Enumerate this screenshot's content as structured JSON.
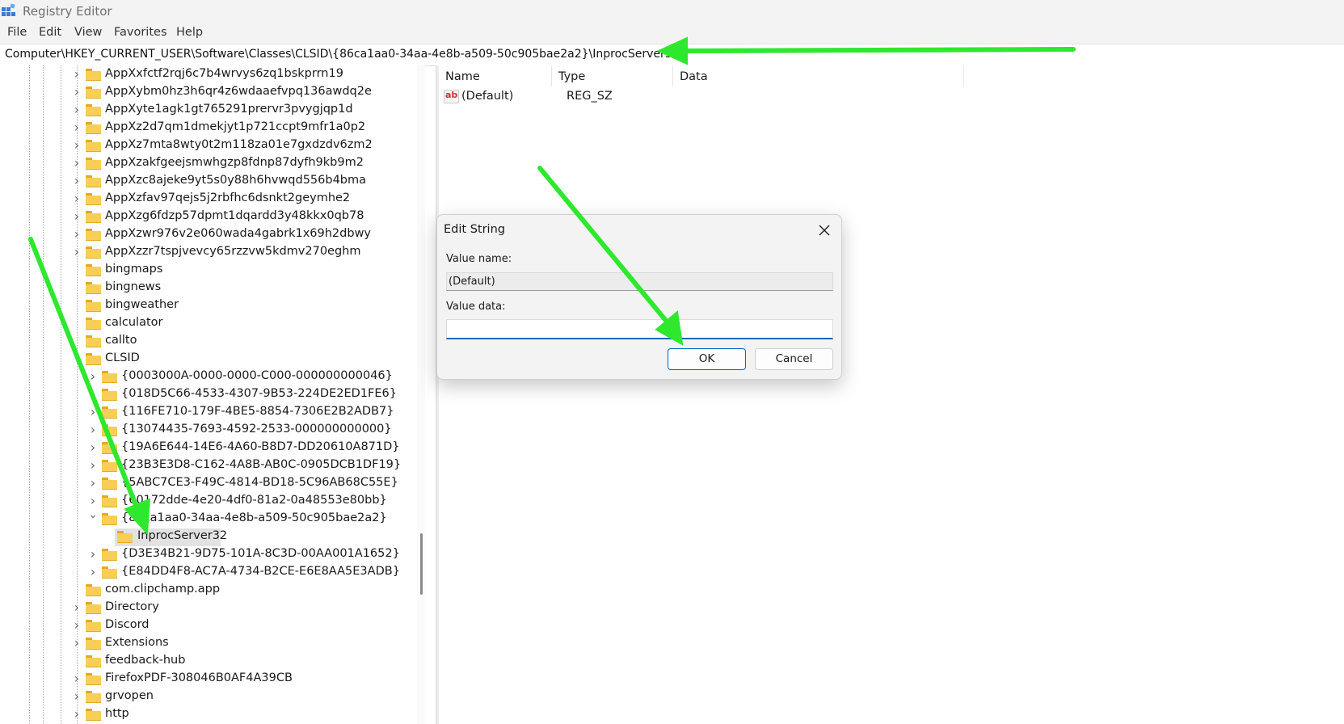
{
  "window": {
    "title": "Registry Editor"
  },
  "menu": [
    "File",
    "Edit",
    "View",
    "Favorites",
    "Help"
  ],
  "address": {
    "path": "Computer\\HKEY_CURRENT_USER\\Software\\Classes\\CLSID\\{86ca1aa0-34aa-4e8b-a509-50c905bae2a2}\\InprocServer32"
  },
  "tree": {
    "items": [
      {
        "label": "AppXxfctf2rqj6c7b4wrvys6zq1bskprrn19",
        "level": 1,
        "expander": "collapsed"
      },
      {
        "label": "AppXybm0hz3h6qr4z6wdaaefvpq136awdq2e",
        "level": 1,
        "expander": "collapsed"
      },
      {
        "label": "AppXyte1agk1gt765291prervr3pvygjqp1d",
        "level": 1,
        "expander": "collapsed"
      },
      {
        "label": "AppXz2d7qm1dmekjyt1p721ccpt9mfr1a0p2",
        "level": 1,
        "expander": "collapsed"
      },
      {
        "label": "AppXz7mta8wty0t2m118za01e7gxdzdv6zm2",
        "level": 1,
        "expander": "collapsed"
      },
      {
        "label": "AppXzakfgeejsmwhgzp8fdnp87dyfh9kb9m2",
        "level": 1,
        "expander": "collapsed"
      },
      {
        "label": "AppXzc8ajeke9yt5s0y88h6hvwqd556b4bma",
        "level": 1,
        "expander": "collapsed"
      },
      {
        "label": "AppXzfav97qejs5j2rbfhc6dsnkt2geymhe2",
        "level": 1,
        "expander": "collapsed"
      },
      {
        "label": "AppXzg6fdzp57dpmt1dqardd3y48kkx0qb78",
        "level": 1,
        "expander": "collapsed"
      },
      {
        "label": "AppXzwr976v2e060wada4gabrk1x69h2dbwy",
        "level": 1,
        "expander": "collapsed"
      },
      {
        "label": "AppXzzr7tspjvevcy65rzzvw5kdmv270eghm",
        "level": 1,
        "expander": "collapsed"
      },
      {
        "label": "bingmaps",
        "level": 1,
        "expander": "none"
      },
      {
        "label": "bingnews",
        "level": 1,
        "expander": "none"
      },
      {
        "label": "bingweather",
        "level": 1,
        "expander": "none"
      },
      {
        "label": "calculator",
        "level": 1,
        "expander": "none"
      },
      {
        "label": "callto",
        "level": 1,
        "expander": "none"
      },
      {
        "label": "CLSID",
        "level": 1,
        "expander": "expanded"
      },
      {
        "label": "{0003000A-0000-0000-C000-000000000046}",
        "level": 2,
        "expander": "collapsed"
      },
      {
        "label": "{018D5C66-4533-4307-9B53-224DE2ED1FE6}",
        "level": 2,
        "expander": "collapsed"
      },
      {
        "label": "{116FE710-179F-4BE5-8854-7306E2B2ADB7}",
        "level": 2,
        "expander": "collapsed"
      },
      {
        "label": "{13074435-7693-4592-2533-000000000000}",
        "level": 2,
        "expander": "collapsed"
      },
      {
        "label": "{19A6E644-14E6-4A60-B8D7-DD20610A871D}",
        "level": 2,
        "expander": "collapsed"
      },
      {
        "label": "{23B3E3D8-C162-4A8B-AB0C-0905DCB1DF19}",
        "level": 2,
        "expander": "collapsed"
      },
      {
        "label": "{5ABC7CE3-F49C-4814-BD18-5C96AB68C55E}",
        "level": 2,
        "expander": "collapsed"
      },
      {
        "label": "{60172dde-4e20-4df0-81a2-0a48553e80bb}",
        "level": 2,
        "expander": "collapsed"
      },
      {
        "label": "{86ca1aa0-34aa-4e8b-a509-50c905bae2a2}",
        "level": 2,
        "expander": "expanded"
      },
      {
        "label": "InprocServer32",
        "level": 3,
        "expander": "none",
        "selected": true
      },
      {
        "label": "{D3E34B21-9D75-101A-8C3D-00AA001A1652}",
        "level": 2,
        "expander": "collapsed"
      },
      {
        "label": "{E84DD4F8-AC7A-4734-B2CE-E6E8AA5E3ADB}",
        "level": 2,
        "expander": "collapsed"
      },
      {
        "label": "com.clipchamp.app",
        "level": 1,
        "expander": "none"
      },
      {
        "label": "Directory",
        "level": 1,
        "expander": "collapsed"
      },
      {
        "label": "Discord",
        "level": 1,
        "expander": "collapsed"
      },
      {
        "label": "Extensions",
        "level": 1,
        "expander": "collapsed"
      },
      {
        "label": "feedback-hub",
        "level": 1,
        "expander": "none"
      },
      {
        "label": "FirefoxPDF-308046B0AF4A39CB",
        "level": 1,
        "expander": "collapsed"
      },
      {
        "label": "grvopen",
        "level": 1,
        "expander": "collapsed"
      },
      {
        "label": "http",
        "level": 1,
        "expander": "collapsed"
      }
    ]
  },
  "values": {
    "columns": [
      "Name",
      "Type",
      "Data"
    ],
    "rows": [
      {
        "name": "(Default)",
        "type": "REG_SZ",
        "data": "",
        "icon": "string-value-icon",
        "icon_text": "ab"
      }
    ]
  },
  "dialog": {
    "title": "Edit String",
    "value_name_label": "Value name:",
    "value_name": "(Default)",
    "value_data_label": "Value data:",
    "value_data": "",
    "ok_label": "OK",
    "cancel_label": "Cancel",
    "accent": "#0067c0"
  },
  "annotations": {
    "arrow_color": "#2ee82e"
  }
}
